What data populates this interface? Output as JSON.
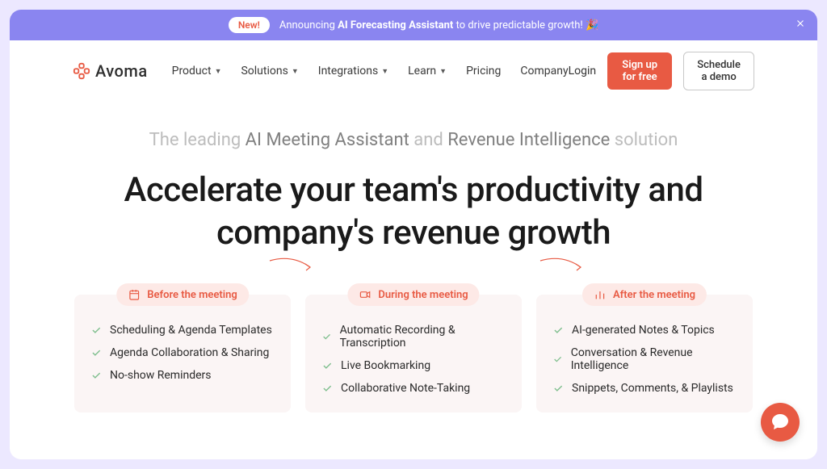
{
  "announcement": {
    "badge": "New!",
    "prefix": "Announcing ",
    "highlight": "AI Forecasting Assistant",
    "suffix": " to drive predictable growth! 🎉"
  },
  "brand": "Avoma",
  "nav": {
    "items": [
      {
        "label": "Product",
        "dropdown": true
      },
      {
        "label": "Solutions",
        "dropdown": true
      },
      {
        "label": "Integrations",
        "dropdown": true
      },
      {
        "label": "Learn",
        "dropdown": true
      },
      {
        "label": "Pricing",
        "dropdown": false
      },
      {
        "label": "Company",
        "dropdown": false
      }
    ]
  },
  "header_right": {
    "login": "Login",
    "signup": "Sign up for free",
    "demo": "Schedule a demo"
  },
  "hero": {
    "sub_prefix": "The leading ",
    "sub_em1": "AI Meeting Assistant",
    "sub_mid": " and ",
    "sub_em2": "Revenue Intelligence",
    "sub_suffix": " solution",
    "main": "Accelerate your team's productivity and company's revenue growth"
  },
  "cards": [
    {
      "title": "Before the meeting",
      "items": [
        "Scheduling & Agenda Templates",
        "Agenda Collaboration & Sharing",
        "No-show Reminders"
      ]
    },
    {
      "title": "During the meeting",
      "items": [
        "Automatic Recording & Transcription",
        "Live Bookmarking",
        "Collaborative Note-Taking"
      ]
    },
    {
      "title": "After the meeting",
      "items": [
        "AI-generated Notes & Topics",
        "Conversation & Revenue Intelligence",
        "Snippets, Comments, & Playlists"
      ]
    }
  ]
}
